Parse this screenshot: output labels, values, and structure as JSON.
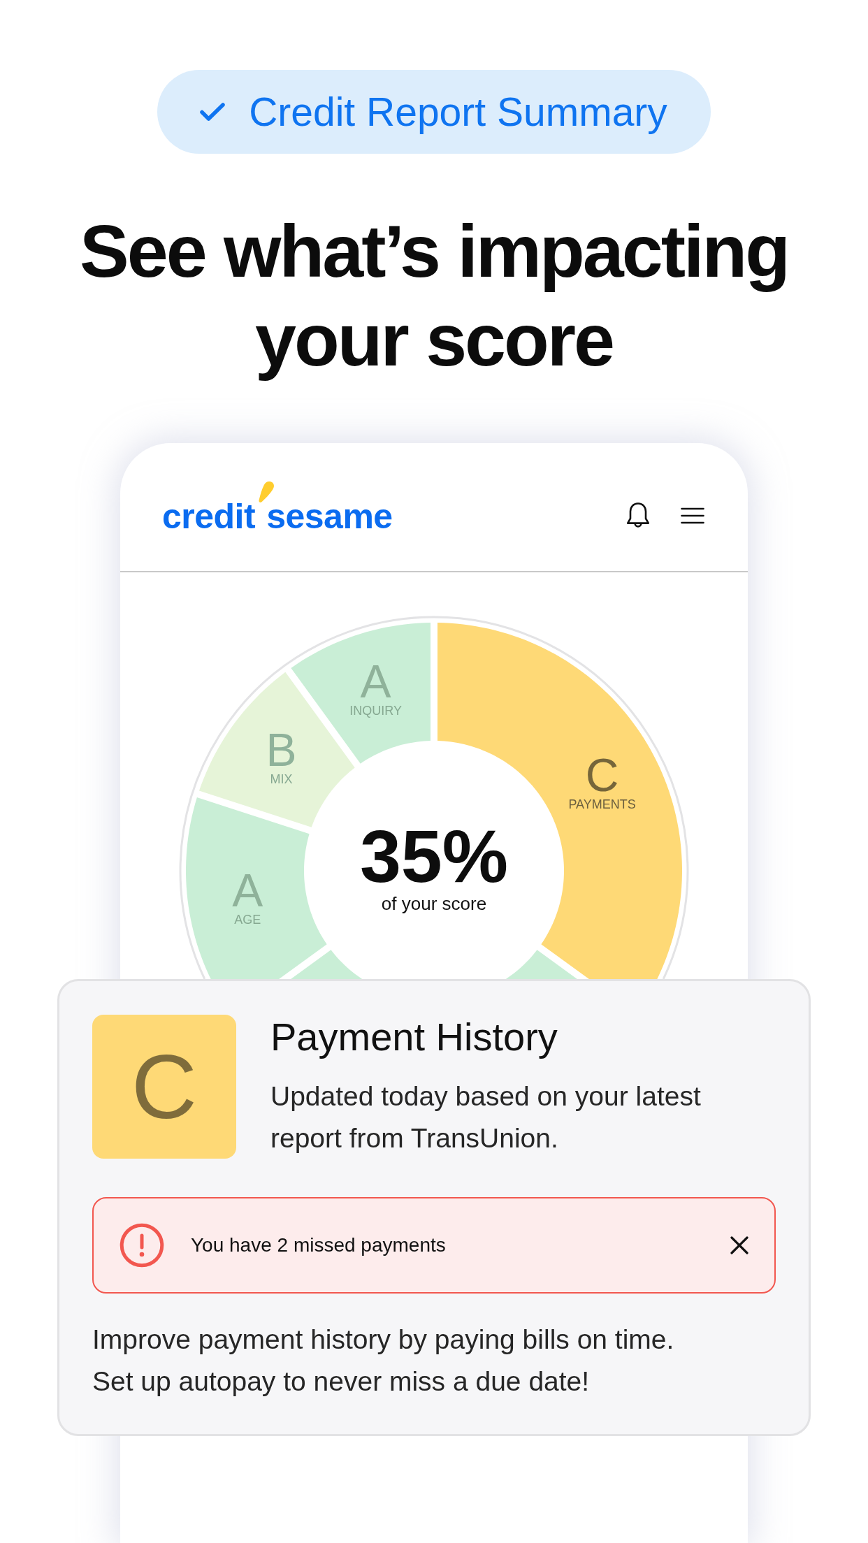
{
  "badge": {
    "label": "Credit Report Summary"
  },
  "headline": "See what’s impacting your score",
  "app": {
    "logo": {
      "words": [
        "credit",
        "sesame"
      ]
    }
  },
  "score_wheel": {
    "share": "35%",
    "caption": "of your score",
    "segments": [
      {
        "grade": "C",
        "label": "PAYMENTS",
        "color": "#fed976",
        "selected": true
      },
      {
        "color": "#c9eed6"
      },
      {
        "grade": "A",
        "label": "AGE",
        "color": "#c9eed6",
        "selected": false
      },
      {
        "grade": "B",
        "label": "MIX",
        "color": "#e6f4d8",
        "selected": false
      },
      {
        "grade": "A",
        "label": "INQUIRY",
        "color": "#c9eed6",
        "selected": false
      }
    ]
  },
  "factor_card": {
    "grade": "C",
    "title": "Payment History",
    "description": [
      "Updated today based on your latest",
      "report from TransUnion."
    ],
    "alert": {
      "message": "You have 2 missed payments"
    },
    "tip": [
      "Improve payment history by paying bills on time.",
      "Set up autopay to never miss a due date!"
    ]
  }
}
